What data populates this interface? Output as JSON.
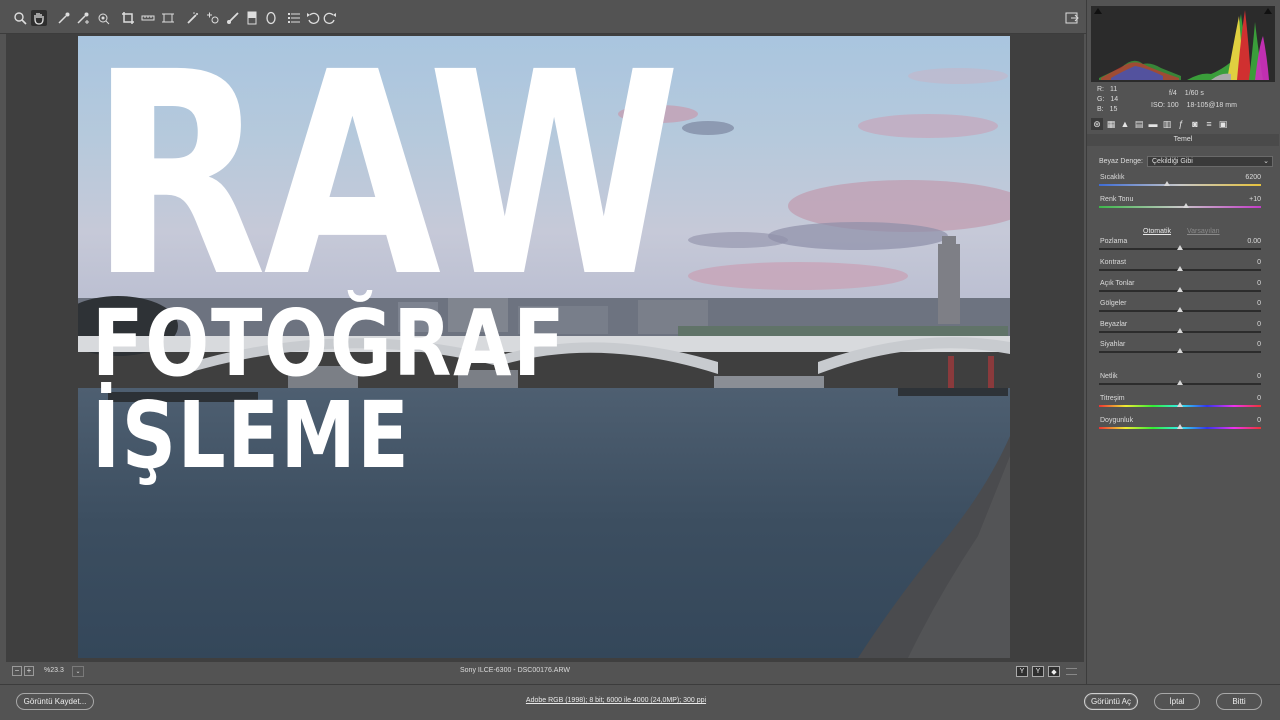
{
  "toolbar": {
    "tools": [
      {
        "name": "zoom-tool",
        "icon": "magnifier-icon"
      },
      {
        "name": "hand-tool",
        "icon": "hand-icon"
      },
      {
        "name": "white-balance-tool",
        "icon": "eyedropper-icon"
      },
      {
        "name": "color-sampler-tool",
        "icon": "color-sampler-icon"
      },
      {
        "name": "targeted-adjustment-tool",
        "icon": "target-icon"
      },
      {
        "name": "crop-tool",
        "icon": "crop-icon"
      },
      {
        "name": "straighten-tool",
        "icon": "straighten-icon"
      },
      {
        "name": "transform-tool",
        "icon": "transform-icon"
      },
      {
        "name": "spot-removal-tool",
        "icon": "spot-removal-icon"
      },
      {
        "name": "red-eye-tool",
        "icon": "red-eye-icon"
      },
      {
        "name": "adjustment-brush-tool",
        "icon": "brush-icon"
      },
      {
        "name": "graduated-filter-tool",
        "icon": "graduated-filter-icon"
      },
      {
        "name": "radial-filter-tool",
        "icon": "radial-filter-icon"
      },
      {
        "name": "preferences-tool",
        "icon": "list-icon"
      },
      {
        "name": "rotate-left-tool",
        "icon": "rotate-left-icon"
      },
      {
        "name": "rotate-right-tool",
        "icon": "rotate-right-icon"
      }
    ]
  },
  "overlay": {
    "title": "RAW",
    "subtitle": "FOTOĞRAF İŞLEME"
  },
  "status": {
    "zoom": "%23.3",
    "file": "Sony ILCE-6300  -  DSC00176.ARW",
    "view_buttons": [
      "Y",
      "Y",
      "◆"
    ]
  },
  "bottom": {
    "save_button": "Görüntü Kaydet...",
    "workflow_link": "Adobe RGB (1998); 8 bit; 6000 ile 4000 (24,0MP); 300 ppi",
    "open_button": "Görüntü Aç",
    "cancel_button": "İptal",
    "done_button": "Bitti"
  },
  "info": {
    "r_label": "R:",
    "r": "11",
    "g_label": "G:",
    "g": "14",
    "b_label": "B:",
    "b": "15",
    "aperture": "f/4",
    "shutter": "1/60 s",
    "iso": "ISO: 100",
    "lens": "18-105@18 mm"
  },
  "panel": {
    "title": "Temel",
    "wb_label": "Beyaz Denge:",
    "wb_value": "Çekildiği Gibi",
    "auto": "Otomatik",
    "defaults": "Varsayılan",
    "sliders": [
      {
        "label": "Sıcaklık",
        "value": "6200",
        "position": 0.42,
        "type": "temp"
      },
      {
        "label": "Renk Tonu",
        "value": "+10",
        "position": 0.54,
        "type": "tint"
      },
      {
        "label": "Pozlama",
        "value": "0.00",
        "position": 0.5,
        "type": "plain"
      },
      {
        "label": "Kontrast",
        "value": "0",
        "position": 0.5,
        "type": "plain"
      },
      {
        "label": "Açık Tonlar",
        "value": "0",
        "position": 0.5,
        "type": "plain"
      },
      {
        "label": "Gölgeler",
        "value": "0",
        "position": 0.5,
        "type": "plain"
      },
      {
        "label": "Beyazlar",
        "value": "0",
        "position": 0.5,
        "type": "plain"
      },
      {
        "label": "Siyahlar",
        "value": "0",
        "position": 0.5,
        "type": "plain"
      },
      {
        "label": "Netlik",
        "value": "0",
        "position": 0.5,
        "type": "plain"
      },
      {
        "label": "Titreşim",
        "value": "0",
        "position": 0.5,
        "type": "spectrum"
      },
      {
        "label": "Doygunluk",
        "value": "0",
        "position": 0.5,
        "type": "spectrum"
      }
    ]
  },
  "colors": {
    "ui_bg": "#535353",
    "canvas_bg": "#3f3f3f",
    "accent_text": "#ffffff"
  }
}
